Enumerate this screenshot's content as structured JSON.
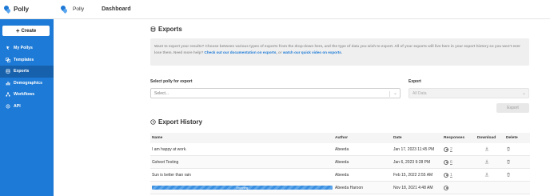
{
  "app": {
    "name": "Polly",
    "workspace": "Polly",
    "page_tab": "Dashboard"
  },
  "sidebar": {
    "create_label": "Create",
    "items": [
      {
        "label": "My Pollys",
        "icon": "polly-icon",
        "active": false
      },
      {
        "label": "Templates",
        "icon": "templates-icon",
        "active": false
      },
      {
        "label": "Exports",
        "icon": "exports-icon",
        "active": true
      },
      {
        "label": "Demographics",
        "icon": "demographics-icon",
        "active": false
      },
      {
        "label": "Workflows",
        "icon": "workflows-icon",
        "active": false
      },
      {
        "label": "API",
        "icon": "api-icon",
        "active": false
      }
    ]
  },
  "exports": {
    "title": "Exports",
    "info_text": "Want to export your results? Choose between various types of exports from the drop-down here, and the type of data you wish to export. All of your exports will live here in your export history so you won't ever lose them. Need more help?",
    "info_link1": "Check out our documentation on exports",
    "info_mid": ", or",
    "info_link2": "watch our quick video on exports",
    "info_end": ".",
    "select_polly_label": "Select polly for export",
    "select_polly_placeholder": "Select...",
    "export_label": "Export",
    "export_value": "All Data",
    "export_button": "Export"
  },
  "history": {
    "title": "Export History",
    "columns": [
      "Name",
      "Author",
      "Date",
      "Responses",
      "Download",
      "Delete"
    ],
    "rows": [
      {
        "name": "I am happy at work.",
        "author": "Abeeda",
        "date": "Jan 17, 2023 11:45 PM",
        "responses": "2",
        "status": "done"
      },
      {
        "name": "Gsheet Testing",
        "author": "Abeeda",
        "date": "Jan 6, 2023 9:28 PM",
        "responses": "6",
        "status": "done"
      },
      {
        "name": "Sun is better than rain",
        "author": "Abeeda",
        "date": "Feb 15, 2022 2:55 AM",
        "responses": "1",
        "status": "done"
      },
      {
        "name": "Exporting",
        "author": "Abeeda Haroon",
        "date": "Nov 18, 2021 4:48 AM",
        "responses": "",
        "status": "exporting"
      }
    ]
  },
  "colors": {
    "sidebar": "#1d7ad6",
    "sidebar_active": "#1761ac",
    "link": "#1d7ad6"
  }
}
